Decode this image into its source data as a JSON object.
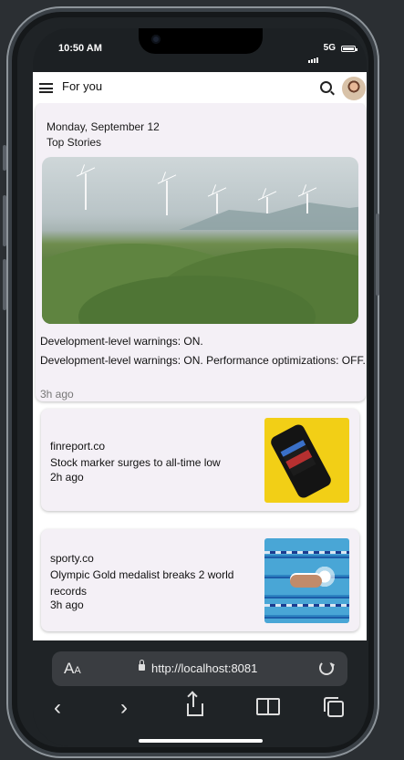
{
  "status_bar": {
    "time": "10:50 AM",
    "network": "5G"
  },
  "app_bar": {
    "title": "For you"
  },
  "top_stories": {
    "date": "Monday, September 12",
    "section_title": "Top Stories",
    "headline": "Development-level warnings: ON.",
    "body": "Development-level warnings: ON. Performance optimizations: OFF.",
    "time_ago": "3h ago"
  },
  "articles": [
    {
      "source": "finreport.co",
      "title": "Stock marker surges to all-time low",
      "time_ago": "2h ago"
    },
    {
      "source": "sporty.co",
      "title": "Olympic Gold medalist breaks 2 world records",
      "time_ago": "3h ago"
    }
  ],
  "browser": {
    "text_size_label_large": "A",
    "text_size_label_small": "A",
    "url": "http://localhost:8081"
  },
  "icons": {
    "menu": "menu-icon",
    "search": "search-icon",
    "back": "chevron-left-icon",
    "forward": "chevron-right-icon",
    "share": "share-icon",
    "bookmarks": "book-icon",
    "tabs": "tabs-icon",
    "reload": "reload-icon",
    "lock": "lock-icon"
  }
}
